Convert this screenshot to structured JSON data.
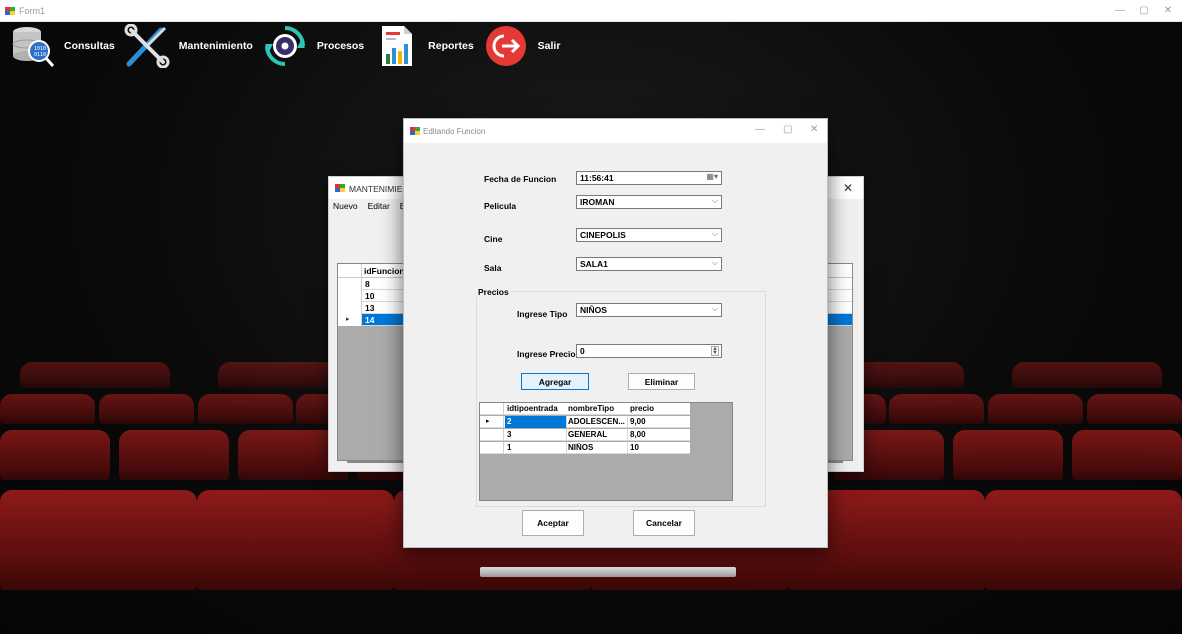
{
  "window": {
    "title": "Form1",
    "minimize": "—",
    "maximize": "▢",
    "close": "✕"
  },
  "toolbar": [
    {
      "label": "Consultas",
      "icon": "database-search-icon"
    },
    {
      "label": "Mantenimiento",
      "icon": "tools-icon"
    },
    {
      "label": "Procesos",
      "icon": "gear-process-icon"
    },
    {
      "label": "Reportes",
      "icon": "report-chart-icon"
    },
    {
      "label": "Salir",
      "icon": "exit-icon"
    }
  ],
  "mantenimiento": {
    "title": "MANTENIMIENTO",
    "close": "✕",
    "menu": [
      "Nuevo",
      "Editar",
      "Elimin"
    ],
    "grid": {
      "column": "idFuncion",
      "rows": [
        "8",
        "10",
        "13",
        "14"
      ],
      "selected_row": 3
    }
  },
  "dialog": {
    "title": "Editando Funcion",
    "minimize": "—",
    "maximize": "▢",
    "close": "✕",
    "fields": {
      "fecha_label": "Fecha de Funcion",
      "fecha_value": "11:56:41",
      "pelicula_label": "Pelicula",
      "pelicula_value": "IROMAN",
      "cine_label": "Cine",
      "cine_value": "CINEPOLIS",
      "sala_label": "Sala",
      "sala_value": "SALA1"
    },
    "precios": {
      "group_title": "Precios",
      "tipo_label": "Ingrese Tipo",
      "tipo_value": "NIÑOS",
      "precio_label": "Ingrese Precio",
      "precio_value": "0",
      "agregar": "Agregar",
      "eliminar": "Eliminar",
      "grid": {
        "columns": [
          "idtipoentrada",
          "nombreTipo",
          "precio"
        ],
        "rows": [
          [
            "2",
            "ADOLESCEN...",
            "9,00"
          ],
          [
            "3",
            "GENERAL",
            "8,00"
          ],
          [
            "1",
            "NIÑOS",
            "10"
          ]
        ],
        "selected_row": 0
      }
    },
    "aceptar": "Aceptar",
    "cancelar": "Cancelar"
  },
  "colors": {
    "accent_selection": "#0078d7",
    "exit_red": "#e53935",
    "seat_red": "#8e1a1a"
  }
}
